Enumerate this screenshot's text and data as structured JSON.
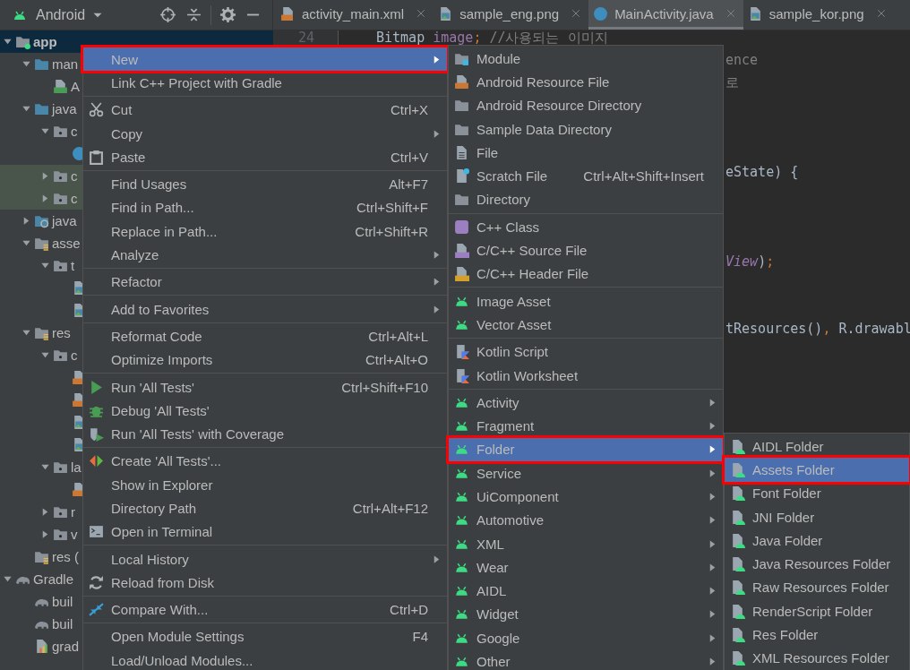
{
  "project_view": {
    "title": "Android"
  },
  "tabs": [
    {
      "label": "activity_main.xml",
      "kind": "xml",
      "selected": false
    },
    {
      "label": "sample_eng.png",
      "kind": "image",
      "selected": false
    },
    {
      "label": "MainActivity.java",
      "kind": "class",
      "selected": true
    },
    {
      "label": "sample_kor.png",
      "kind": "image",
      "selected": false
    }
  ],
  "tree": [
    {
      "label": "app",
      "kind": "module",
      "selected": true,
      "expanded": true,
      "children": [
        {
          "label": "man",
          "kind": "source-folder",
          "selected": false,
          "expanded": true,
          "children": [
            {
              "label": "A",
              "kind": "manifest",
              "selected": false
            }
          ]
        },
        {
          "label": "java",
          "kind": "source-folder",
          "selected": false,
          "expanded": true,
          "children": [
            {
              "label": "c",
              "kind": "package",
              "selected": false,
              "expanded": true,
              "children": [
                {
                  "kind": "class",
                  "selected": false
                }
              ]
            },
            {
              "label": "c",
              "kind": "test-package",
              "selected": false,
              "expanded": false
            },
            {
              "label": "c",
              "kind": "test-package",
              "selected": false,
              "expanded": false
            }
          ]
        },
        {
          "label": "java",
          "kind": "generated-folder",
          "selected": false,
          "expanded": false
        },
        {
          "label": "asse",
          "kind": "resource-folder",
          "selected": false,
          "expanded": true,
          "children": [
            {
              "label": "t",
              "kind": "folder",
              "selected": false,
              "expanded": true,
              "children": [
                {
                  "kind": "image",
                  "selected": false
                },
                {
                  "kind": "image",
                  "selected": false
                }
              ]
            }
          ]
        },
        {
          "label": "res",
          "kind": "resource-folder",
          "selected": false,
          "expanded": true,
          "children": [
            {
              "label": "c",
              "kind": "package",
              "selected": false,
              "expanded": true,
              "children": [
                {
                  "kind": "xml",
                  "selected": false
                },
                {
                  "kind": "xml",
                  "selected": false
                },
                {
                  "kind": "image",
                  "selected": false
                },
                {
                  "kind": "image",
                  "selected": false
                }
              ]
            },
            {
              "label": "la",
              "kind": "package",
              "selected": false,
              "expanded": true,
              "children": [
                {
                  "kind": "xml",
                  "selected": false
                }
              ]
            },
            {
              "label": "r",
              "kind": "package",
              "selected": false,
              "expanded": false
            },
            {
              "label": "v",
              "kind": "package",
              "selected": false,
              "expanded": false
            }
          ]
        },
        {
          "label": "res (",
          "kind": "resource-folder",
          "selected": false
        }
      ]
    },
    {
      "label": "Gradle",
      "kind": "gradle",
      "selected": false,
      "expanded": true,
      "children": [
        {
          "label": "buil",
          "kind": "gradle",
          "selected": false
        },
        {
          "label": "buil",
          "kind": "gradle",
          "selected": false
        },
        {
          "label": "grad",
          "kind": "properties",
          "selected": false
        }
      ]
    }
  ],
  "editor": {
    "line_number": "24",
    "line": [
      {
        "text": "Bitmap ",
        "kind": "plain"
      },
      {
        "text": "image",
        "kind": "field"
      },
      {
        "text": ";",
        "kind": "punct"
      },
      {
        "text": " //사용되는 이미지",
        "kind": "comment"
      }
    ],
    "partial_lines": [
      {
        "tokens": [
          {
            "text": "ence",
            "kind": "comment"
          }
        ]
      },
      {
        "tokens": [
          {
            "text": "로",
            "kind": "comment"
          }
        ]
      },
      {
        "tokens": [
          {
            "text": "eState) {",
            "kind": "plain"
          }
        ]
      },
      {
        "tokens": [
          {
            "text": "View",
            "kind": "field-italic"
          },
          {
            "text": ")",
            "kind": "plain"
          },
          {
            "text": ";",
            "kind": "punct"
          }
        ]
      },
      {
        "tokens": [
          {
            "text": "tResources()",
            "kind": "plain"
          },
          {
            "text": ",",
            "kind": "punct"
          },
          {
            "text": " R.drawabl",
            "kind": "plain"
          }
        ]
      }
    ]
  },
  "menus": [
    {
      "items": [
        {
          "label": "New",
          "submenu": true,
          "selected": true
        },
        {
          "label": "Link C++ Project with Gradle",
          "submenu": false,
          "selected": false
        },
        {
          "kind": "separator"
        },
        {
          "label": "Cut",
          "shortcut": "Ctrl+X",
          "submenu": false,
          "selected": false
        },
        {
          "label": "Copy",
          "submenu": true,
          "selected": false
        },
        {
          "label": "Paste",
          "shortcut": "Ctrl+V",
          "submenu": false,
          "selected": false
        },
        {
          "kind": "separator"
        },
        {
          "label": "Find Usages",
          "shortcut": "Alt+F7",
          "submenu": false,
          "selected": false
        },
        {
          "label": "Find in Path...",
          "shortcut": "Ctrl+Shift+F",
          "submenu": false,
          "selected": false
        },
        {
          "label": "Replace in Path...",
          "shortcut": "Ctrl+Shift+R",
          "submenu": false,
          "selected": false
        },
        {
          "label": "Analyze",
          "submenu": true,
          "selected": false
        },
        {
          "kind": "separator"
        },
        {
          "label": "Refactor",
          "submenu": true,
          "selected": false
        },
        {
          "kind": "separator"
        },
        {
          "label": "Add to Favorites",
          "submenu": true,
          "selected": false
        },
        {
          "kind": "separator"
        },
        {
          "label": "Reformat Code",
          "shortcut": "Ctrl+Alt+L",
          "submenu": false,
          "selected": false
        },
        {
          "label": "Optimize Imports",
          "shortcut": "Ctrl+Alt+O",
          "submenu": false,
          "selected": false
        },
        {
          "kind": "separator"
        },
        {
          "label": "Run 'All Tests'",
          "shortcut": "Ctrl+Shift+F10",
          "submenu": false,
          "selected": false
        },
        {
          "label": "Debug 'All Tests'",
          "submenu": false,
          "selected": false
        },
        {
          "label": "Run 'All Tests' with Coverage",
          "submenu": false,
          "selected": false
        },
        {
          "kind": "separator"
        },
        {
          "label": "Create 'All Tests'...",
          "submenu": false,
          "selected": false
        },
        {
          "label": "Show in Explorer",
          "submenu": false,
          "selected": false
        },
        {
          "label": "Directory Path",
          "shortcut": "Ctrl+Alt+F12",
          "submenu": false,
          "selected": false
        },
        {
          "label": "Open in Terminal",
          "submenu": false,
          "selected": false
        },
        {
          "kind": "separator"
        },
        {
          "label": "Local History",
          "submenu": true,
          "selected": false
        },
        {
          "label": "Reload from Disk",
          "submenu": false,
          "selected": false
        },
        {
          "kind": "separator"
        },
        {
          "label": "Compare With...",
          "shortcut": "Ctrl+D",
          "submenu": false,
          "selected": false
        },
        {
          "kind": "separator"
        },
        {
          "label": "Open Module Settings",
          "shortcut": "F4",
          "submenu": false,
          "selected": false
        },
        {
          "label": "Load/Unload Modules...",
          "submenu": false,
          "selected": false
        }
      ]
    },
    {
      "items": [
        {
          "label": "Module",
          "submenu": false,
          "selected": false
        },
        {
          "label": "Android Resource File",
          "submenu": false,
          "selected": false
        },
        {
          "label": "Android Resource Directory",
          "submenu": false,
          "selected": false
        },
        {
          "label": "Sample Data Directory",
          "submenu": false,
          "selected": false
        },
        {
          "label": "File",
          "submenu": false,
          "selected": false
        },
        {
          "label": "Scratch File",
          "shortcut": "Ctrl+Alt+Shift+Insert",
          "submenu": false,
          "selected": false
        },
        {
          "label": "Directory",
          "submenu": false,
          "selected": false
        },
        {
          "kind": "separator"
        },
        {
          "label": "C++ Class",
          "submenu": false,
          "selected": false
        },
        {
          "label": "C/C++ Source File",
          "submenu": false,
          "selected": false
        },
        {
          "label": "C/C++ Header File",
          "submenu": false,
          "selected": false
        },
        {
          "kind": "separator"
        },
        {
          "label": "Image Asset",
          "submenu": false,
          "selected": false
        },
        {
          "label": "Vector Asset",
          "submenu": false,
          "selected": false
        },
        {
          "kind": "separator"
        },
        {
          "label": "Kotlin Script",
          "submenu": false,
          "selected": false
        },
        {
          "label": "Kotlin Worksheet",
          "submenu": false,
          "selected": false
        },
        {
          "kind": "separator"
        },
        {
          "label": "Activity",
          "submenu": true,
          "selected": false
        },
        {
          "label": "Fragment",
          "submenu": true,
          "selected": false
        },
        {
          "label": "Folder",
          "submenu": true,
          "selected": true
        },
        {
          "label": "Service",
          "submenu": true,
          "selected": false
        },
        {
          "label": "UiComponent",
          "submenu": true,
          "selected": false
        },
        {
          "label": "Automotive",
          "submenu": true,
          "selected": false
        },
        {
          "label": "XML",
          "submenu": true,
          "selected": false
        },
        {
          "label": "Wear",
          "submenu": true,
          "selected": false
        },
        {
          "label": "AIDL",
          "submenu": true,
          "selected": false
        },
        {
          "label": "Widget",
          "submenu": true,
          "selected": false
        },
        {
          "label": "Google",
          "submenu": true,
          "selected": false
        },
        {
          "label": "Other",
          "submenu": true,
          "selected": false
        }
      ]
    },
    {
      "items": [
        {
          "label": "AIDL Folder",
          "submenu": false,
          "selected": false
        },
        {
          "label": "Assets Folder",
          "submenu": false,
          "selected": true
        },
        {
          "label": "Font Folder",
          "submenu": false,
          "selected": false
        },
        {
          "label": "JNI Folder",
          "submenu": false,
          "selected": false
        },
        {
          "label": "Java Folder",
          "submenu": false,
          "selected": false
        },
        {
          "label": "Java Resources Folder",
          "submenu": false,
          "selected": false
        },
        {
          "label": "Raw Resources Folder",
          "submenu": false,
          "selected": false
        },
        {
          "label": "RenderScript Folder",
          "submenu": false,
          "selected": false
        },
        {
          "label": "Res Folder",
          "submenu": false,
          "selected": false
        },
        {
          "label": "XML Resources Folder",
          "submenu": false,
          "selected": false
        }
      ]
    }
  ]
}
